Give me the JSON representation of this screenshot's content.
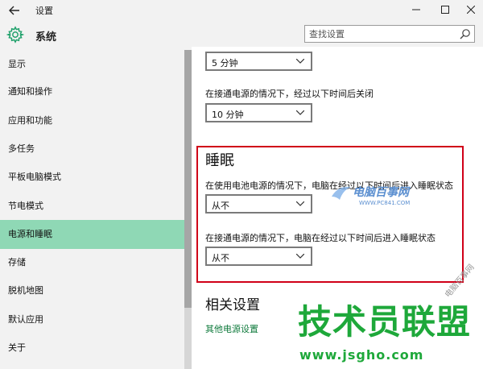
{
  "window": {
    "title": "设置",
    "back_icon": "back-arrow-icon",
    "min_glyph": "—",
    "max_glyph": "☐",
    "close_glyph": "✕"
  },
  "header": {
    "title": "系统",
    "icon": "gear-icon",
    "search_placeholder": "查找设置"
  },
  "sidebar": {
    "items": [
      {
        "label": "显示"
      },
      {
        "label": "通知和操作"
      },
      {
        "label": "应用和功能"
      },
      {
        "label": "多任务"
      },
      {
        "label": "平板电脑模式"
      },
      {
        "label": "节电模式"
      },
      {
        "label": "电源和睡眠",
        "active": true
      },
      {
        "label": "存储"
      },
      {
        "label": "脱机地图"
      },
      {
        "label": "默认应用"
      },
      {
        "label": "关于"
      }
    ]
  },
  "main": {
    "screen_battery_value": "5 分钟",
    "screen_plugged_label": "在接通电源的情况下，经过以下时间后关闭",
    "screen_plugged_value": "10 分钟",
    "sleep": {
      "heading": "睡眠",
      "battery_label": "在使用电池电源的情况下，电脑在经过以下时间后进入睡眠状态",
      "battery_value": "从不",
      "plugged_label": "在接通电源的情况下，电脑在经过以下时间后进入睡眠状态",
      "plugged_value": "从不"
    },
    "related": {
      "heading": "相关设置",
      "link": "其他电源设置"
    }
  },
  "watermarks": {
    "logo_text": "电脑百事网",
    "logo_url": "WWW.PC841.COM",
    "big_text": "技术员联盟",
    "url": "www.jsgho.com",
    "side_text": "电脑百事网"
  },
  "colors": {
    "sidebar_active": "#8fd8b5",
    "highlight_border": "#d00018",
    "link": "#0f7a3c",
    "watermark_green": "#1ea83a"
  }
}
